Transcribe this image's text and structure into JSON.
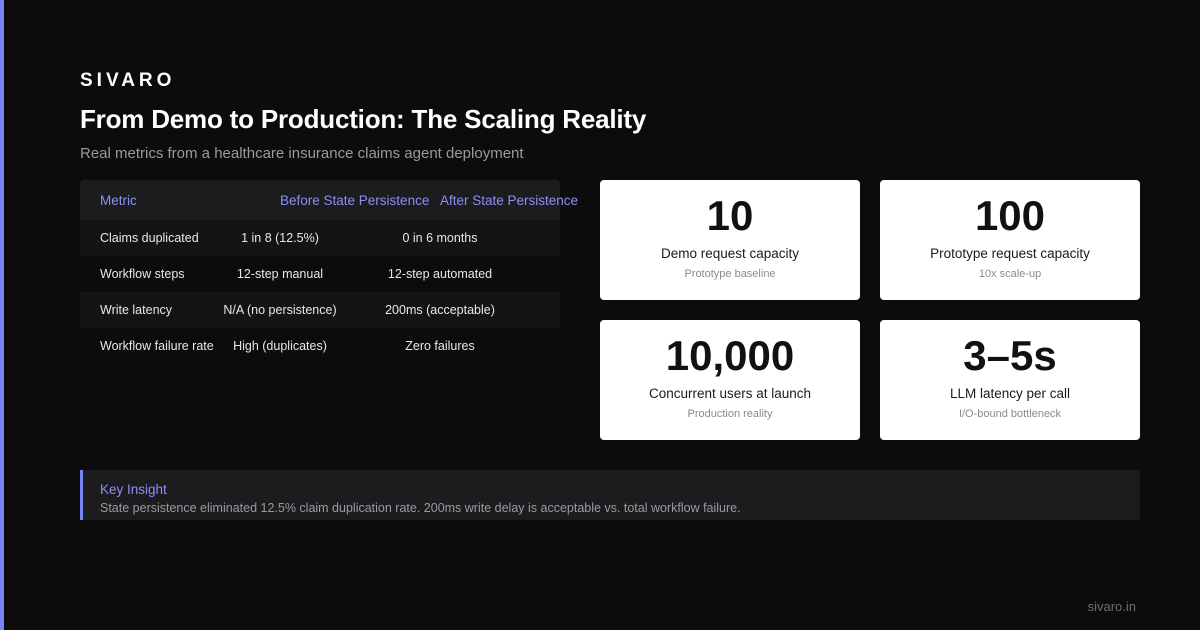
{
  "brand": "SIVARO",
  "title": "From Demo to Production: The Scaling Reality",
  "subtitle": "Real metrics from a healthcare insurance claims agent deployment",
  "table": {
    "headers": [
      "Metric",
      "Before State Persistence",
      "After State Persistence"
    ],
    "rows": [
      [
        "Claims duplicated",
        "1 in 8 (12.5%)",
        "0 in 6 months"
      ],
      [
        "Workflow steps",
        "12-step manual",
        "12-step automated"
      ],
      [
        "Write latency",
        "N/A (no persistence)",
        "200ms (acceptable)"
      ],
      [
        "Workflow failure rate",
        "High (duplicates)",
        "Zero failures"
      ]
    ]
  },
  "cards": [
    {
      "value": "10",
      "label": "Demo request capacity",
      "sub": "Prototype baseline"
    },
    {
      "value": "100",
      "label": "Prototype request capacity",
      "sub": "10x scale-up"
    },
    {
      "value": "10,000",
      "label": "Concurrent users at launch",
      "sub": "Production reality"
    },
    {
      "value": "3–5s",
      "label": "LLM latency per call",
      "sub": "I/O-bound bottleneck"
    }
  ],
  "insight": {
    "title": "Key Insight",
    "text": "State persistence eliminated 12.5% claim duplication rate. 200ms write delay is acceptable vs. total workflow failure."
  },
  "footer": "sivaro.in",
  "colors": {
    "background": "#0c0c0c",
    "accent": "#7c83f5",
    "card": "#ffffff"
  }
}
